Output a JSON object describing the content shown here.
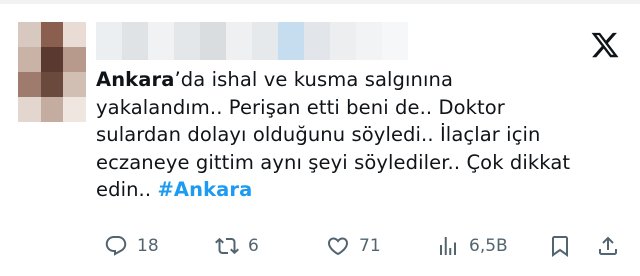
{
  "tweet": {
    "text": {
      "line1_bold": "Ankara",
      "line1_rest": "’da ishal ve kusma salgınına",
      "line2": "yakalandım.. Perişan etti beni de.. Doktor",
      "line3": "sulardan dolayı olduğunu söyledi.. İlaçlar için",
      "line4": "eczaneye gittim aynı şeyi söylediler.. Çok dikkat",
      "line5_prefix": "edin.. ",
      "hashtag": "#Ankara"
    },
    "actions": {
      "reply_count": "18",
      "retweet_count": "6",
      "like_count": "71",
      "view_count": "6,5B"
    }
  },
  "icons": {
    "logo": "x-logo-icon",
    "reply": "reply-icon",
    "retweet": "retweet-icon",
    "like": "heart-icon",
    "views": "views-icon",
    "bookmark": "bookmark-icon",
    "share": "share-icon"
  },
  "colors": {
    "text": "#0f1419",
    "hashtag": "#1d9bf0",
    "icon_gray": "#536471"
  }
}
